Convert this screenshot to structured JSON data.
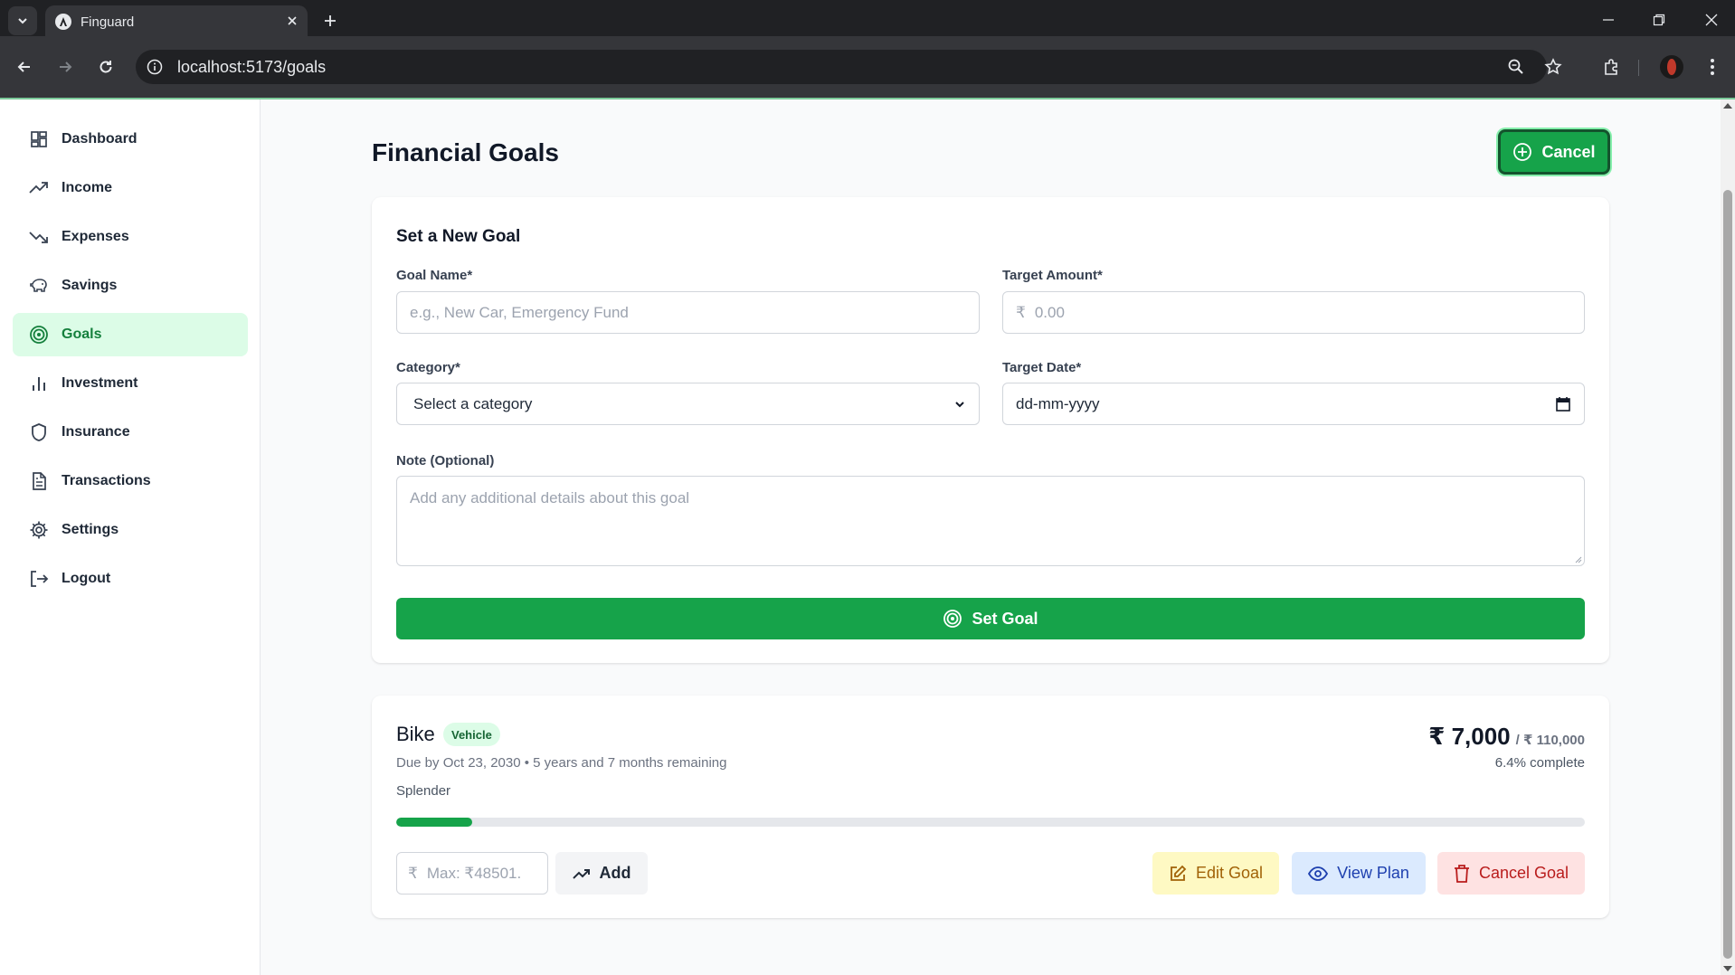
{
  "browser": {
    "tab_title": "Finguard",
    "url": "localhost:5173/goals"
  },
  "sidebar": {
    "items": [
      {
        "label": "Dashboard",
        "icon": "dashboard-icon"
      },
      {
        "label": "Income",
        "icon": "trending-up-icon"
      },
      {
        "label": "Expenses",
        "icon": "trending-down-icon"
      },
      {
        "label": "Savings",
        "icon": "piggy-bank-icon"
      },
      {
        "label": "Goals",
        "icon": "target-icon",
        "active": true
      },
      {
        "label": "Investment",
        "icon": "bar-chart-icon"
      },
      {
        "label": "Insurance",
        "icon": "shield-icon"
      },
      {
        "label": "Transactions",
        "icon": "file-text-icon"
      },
      {
        "label": "Settings",
        "icon": "gear-icon"
      },
      {
        "label": "Logout",
        "icon": "logout-icon"
      }
    ]
  },
  "main": {
    "title": "Financial Goals",
    "cancel_label": "Cancel"
  },
  "form": {
    "title": "Set a New Goal",
    "goal_name_label": "Goal Name*",
    "goal_name_placeholder": "e.g., New Car, Emergency Fund",
    "target_amount_label": "Target Amount*",
    "currency_symbol": "₹",
    "target_amount_placeholder": "0.00",
    "category_label": "Category*",
    "category_value": "Select a category",
    "target_date_label": "Target Date*",
    "target_date_value": "dd-mm-yyyy",
    "note_label": "Note (Optional)",
    "note_placeholder": "Add any additional details about this goal",
    "submit_label": "Set Goal"
  },
  "goal": {
    "name": "Bike",
    "category": "Vehicle",
    "due": "Due by Oct 23, 2030 • 5 years and 7 months remaining",
    "note": "Splender",
    "current": "₹ 7,000",
    "target": "/ ₹ 110,000",
    "percent_text": "6.4% complete",
    "progress_fraction": 0.064,
    "contribution_currency": "₹",
    "contribution_placeholder": "Max: ₹48501.",
    "add_label": "Add",
    "edit_label": "Edit Goal",
    "view_label": "View Plan",
    "cancel_label": "Cancel Goal"
  },
  "colors": {
    "primary_green": "#16a34a",
    "active_nav_bg": "#dcfce7"
  }
}
